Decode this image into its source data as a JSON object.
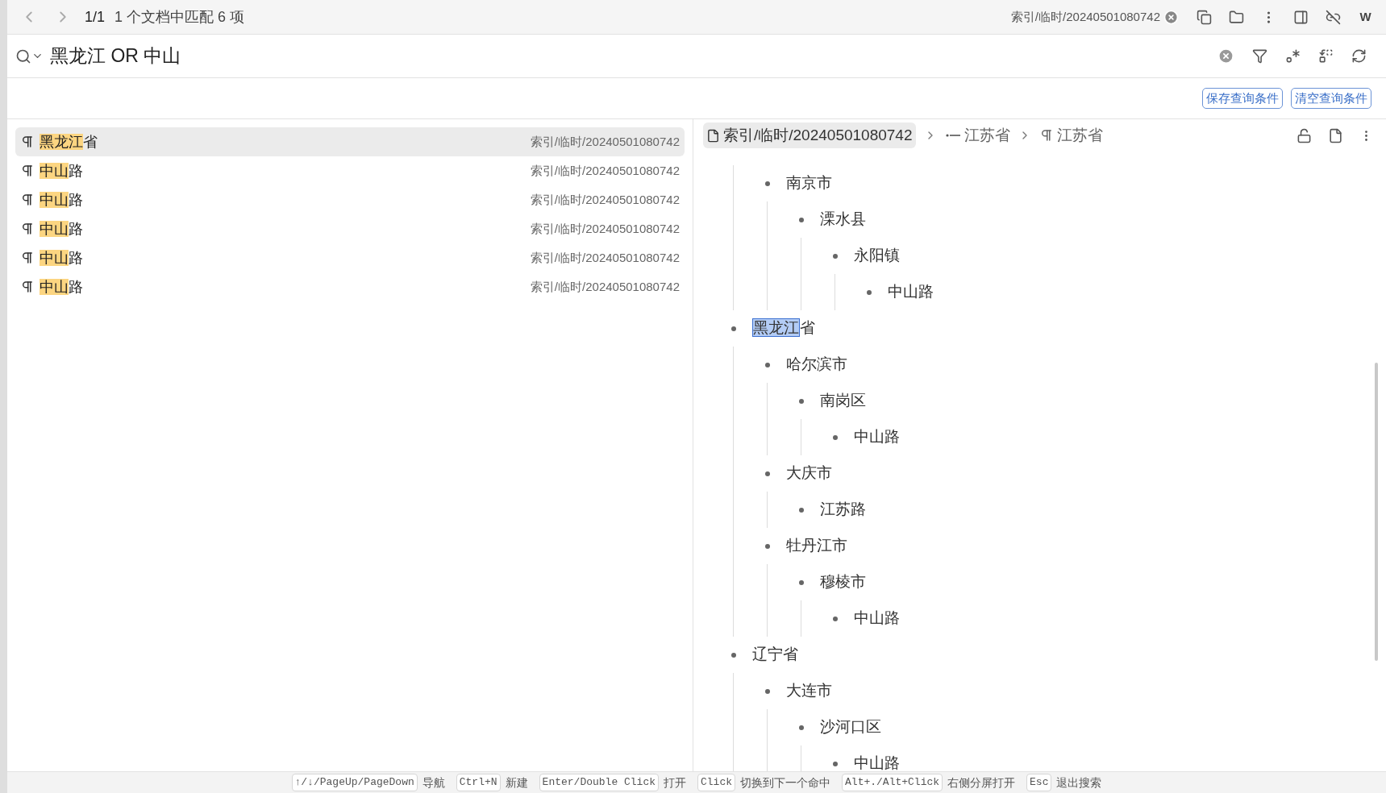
{
  "top_bar": {
    "page": "1/1",
    "summary": "1 个文档中匹配 6 项",
    "doc_path": "索引/临时/20240501080742",
    "user_initial": "W"
  },
  "search": {
    "query": "黑龙江 OR 中山"
  },
  "actions": [
    "保存查询条件",
    "清空查询条件"
  ],
  "results": [
    {
      "parts": [
        {
          "text": "黑龙江",
          "highlighted": true
        },
        {
          "text": "省",
          "highlighted": false
        }
      ],
      "path": "索引/临时/20240501080742",
      "selected": true
    },
    {
      "parts": [
        {
          "text": "中山",
          "highlighted": true
        },
        {
          "text": "路",
          "highlighted": false
        }
      ],
      "path": "索引/临时/20240501080742",
      "selected": false
    },
    {
      "parts": [
        {
          "text": "中山",
          "highlighted": true
        },
        {
          "text": "路",
          "highlighted": false
        }
      ],
      "path": "索引/临时/20240501080742",
      "selected": false
    },
    {
      "parts": [
        {
          "text": "中山",
          "highlighted": true
        },
        {
          "text": "路",
          "highlighted": false
        }
      ],
      "path": "索引/临时/20240501080742",
      "selected": false
    },
    {
      "parts": [
        {
          "text": "中山",
          "highlighted": true
        },
        {
          "text": "路",
          "highlighted": false
        }
      ],
      "path": "索引/临时/20240501080742",
      "selected": false
    },
    {
      "parts": [
        {
          "text": "中山",
          "highlighted": true
        },
        {
          "text": "路",
          "highlighted": false
        }
      ],
      "path": "索引/临时/20240501080742",
      "selected": false
    }
  ],
  "breadcrumb": [
    {
      "kind": "document",
      "label": "索引/临时/20240501080742"
    },
    {
      "kind": "list",
      "label": "江苏省"
    },
    {
      "kind": "paragraph",
      "label": "江苏省"
    }
  ],
  "tree": [
    {
      "children": [
        {
          "parts": [
            {
              "text": "南京市",
              "highlighted": false
            }
          ],
          "children": [
            {
              "parts": [
                {
                  "text": "溧水县",
                  "highlighted": false
                }
              ],
              "children": [
                {
                  "parts": [
                    {
                      "text": "永阳镇",
                      "highlighted": false
                    }
                  ],
                  "children": [
                    {
                      "parts": [
                        {
                          "text": "中山路",
                          "highlighted": false
                        }
                      ]
                    }
                  ]
                }
              ]
            }
          ]
        }
      ]
    },
    {
      "parts": [
        {
          "text": "黑龙江",
          "highlighted": true
        },
        {
          "text": "省",
          "highlighted": false
        }
      ],
      "children": [
        {
          "parts": [
            {
              "text": "哈尔滨市",
              "highlighted": false
            }
          ],
          "children": [
            {
              "parts": [
                {
                  "text": "南岗区",
                  "highlighted": false
                }
              ],
              "children": [
                {
                  "parts": [
                    {
                      "text": "中山路",
                      "highlighted": false
                    }
                  ]
                }
              ]
            }
          ]
        },
        {
          "parts": [
            {
              "text": "大庆市",
              "highlighted": false
            }
          ],
          "children": [
            {
              "parts": [
                {
                  "text": "江苏路",
                  "highlighted": false
                }
              ]
            }
          ]
        },
        {
          "parts": [
            {
              "text": "牡丹江市",
              "highlighted": false
            }
          ],
          "children": [
            {
              "parts": [
                {
                  "text": "穆棱市",
                  "highlighted": false
                }
              ],
              "children": [
                {
                  "parts": [
                    {
                      "text": "中山路",
                      "highlighted": false
                    }
                  ]
                }
              ]
            }
          ]
        }
      ]
    },
    {
      "parts": [
        {
          "text": "辽宁省",
          "highlighted": false
        }
      ],
      "children": [
        {
          "parts": [
            {
              "text": "大连市",
              "highlighted": false
            }
          ],
          "children": [
            {
              "parts": [
                {
                  "text": "沙河口区",
                  "highlighted": false
                }
              ],
              "children": [
                {
                  "parts": [
                    {
                      "text": "中山路",
                      "highlighted": false
                    }
                  ]
                }
              ]
            }
          ]
        }
      ]
    }
  ],
  "shortcuts": [
    {
      "key": "↑/↓/PageUp/PageDown",
      "label": "导航"
    },
    {
      "key": "Ctrl+N",
      "label": "新建"
    },
    {
      "key": "Enter/Double Click",
      "label": "打开"
    },
    {
      "key": "Click",
      "label": "切换到下一个命中"
    },
    {
      "key": "Alt+./Alt+Click",
      "label": "右侧分屏打开"
    },
    {
      "key": "Esc",
      "label": "退出搜索"
    }
  ]
}
